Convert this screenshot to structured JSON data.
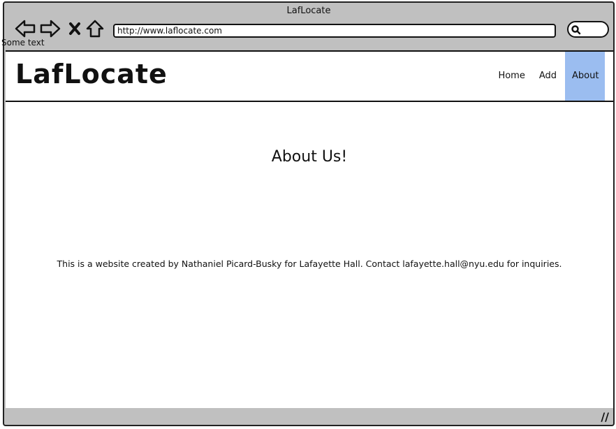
{
  "window": {
    "title": "LafLocate",
    "url": "http://www.laflocate.com",
    "overlay_text": "Some text"
  },
  "header": {
    "logo": "LafLocate",
    "nav": [
      {
        "label": "Home",
        "active": false
      },
      {
        "label": "Add",
        "active": false
      },
      {
        "label": "About",
        "active": true
      }
    ]
  },
  "main": {
    "heading": "About Us!",
    "paragraph": "This is a website created by Nathaniel Picard-Busky for Lafayette Hall. Contact lafayette.hall@nyu.edu for inquiries."
  },
  "colors": {
    "active_nav_bg": "#9bbdf0",
    "chrome_bg": "#c0c0c0"
  },
  "icons": [
    "back-icon",
    "forward-icon",
    "stop-icon",
    "home-icon",
    "search-icon",
    "resize-grip-icon"
  ]
}
